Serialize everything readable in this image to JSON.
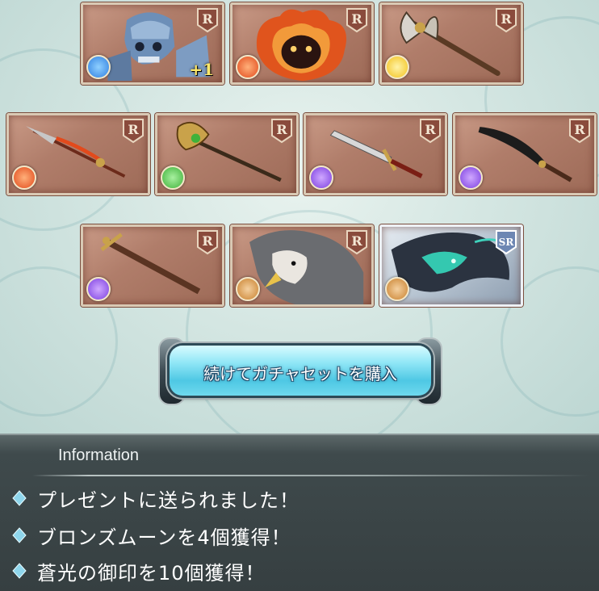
{
  "cards": [
    {
      "id": "card-1",
      "rarity": "R",
      "element": "water",
      "element_color": "#2f7fe0",
      "art": "skeleton-knight",
      "plus": "+1"
    },
    {
      "id": "card-2",
      "rarity": "R",
      "element": "fire",
      "element_color": "#e24a1c",
      "art": "flame-spirit",
      "plus": ""
    },
    {
      "id": "card-3",
      "rarity": "R",
      "element": "light",
      "element_color": "#f2c21b",
      "art": "axe",
      "plus": ""
    },
    {
      "id": "card-4",
      "rarity": "R",
      "element": "fire",
      "element_color": "#e24a1c",
      "art": "spear",
      "plus": ""
    },
    {
      "id": "card-5",
      "rarity": "R",
      "element": "wind",
      "element_color": "#3fb23a",
      "art": "halberd",
      "plus": ""
    },
    {
      "id": "card-6",
      "rarity": "R",
      "element": "dark",
      "element_color": "#7b3fe0",
      "art": "sword",
      "plus": ""
    },
    {
      "id": "card-7",
      "rarity": "R",
      "element": "dark",
      "element_color": "#7b3fe0",
      "art": "scimitar",
      "plus": ""
    },
    {
      "id": "card-8",
      "rarity": "R",
      "element": "dark",
      "element_color": "#7b3fe0",
      "art": "ornate-sword",
      "plus": ""
    },
    {
      "id": "card-9",
      "rarity": "R",
      "element": "earth",
      "element_color": "#c9812e",
      "art": "griffin",
      "plus": ""
    },
    {
      "id": "card-10",
      "rarity": "SR",
      "element": "earth",
      "element_color": "#c9812e",
      "art": "dragon",
      "plus": ""
    }
  ],
  "button": {
    "label": "続けてガチャセットを購入"
  },
  "info": {
    "title": "Information",
    "messages": [
      "プレゼントに送られました！",
      "ブロンズムーンを4個獲得！",
      "蒼光の御印を10個獲得！"
    ]
  }
}
